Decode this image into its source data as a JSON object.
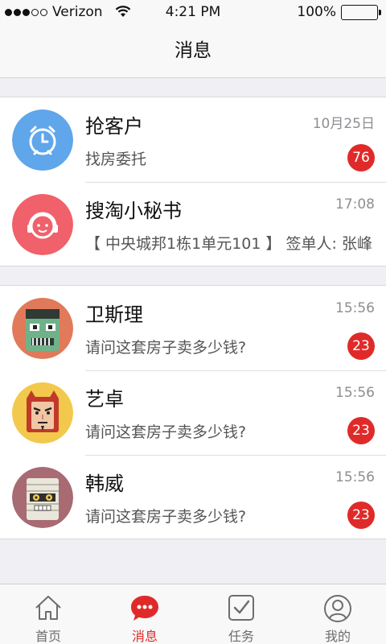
{
  "status_bar": {
    "carrier": "Verizon",
    "time": "4:21 PM",
    "battery": "100%"
  },
  "nav": {
    "title": "消息"
  },
  "group1": [
    {
      "title": "抢客户",
      "time": "10月25日",
      "subtitle": "找房委托",
      "badge": "76",
      "avatar_icon": "alarm-clock-icon",
      "avatar_color": "#5fa6ea"
    },
    {
      "title": "搜淘小秘书",
      "time": "17:08",
      "subtitle": "【 中央城邦1栋1单元101 】 签单人: 张峰",
      "avatar_icon": "headset-icon",
      "avatar_color": "#f0616b"
    }
  ],
  "group2": [
    {
      "title": "卫斯理",
      "time": "15:56",
      "subtitle": "请问这套房子卖多少钱?",
      "badge": "23",
      "avatar_icon": "zombie-avatar-icon",
      "avatar_color": "#e07a5a"
    },
    {
      "title": "艺卓",
      "time": "15:56",
      "subtitle": "请问这套房子卖多少钱?",
      "badge": "23",
      "avatar_icon": "devil-avatar-icon",
      "avatar_color": "#f2c94c"
    },
    {
      "title": "韩威",
      "time": "15:56",
      "subtitle": "请问这套房子卖多少钱?",
      "badge": "23",
      "avatar_icon": "mummy-avatar-icon",
      "avatar_color": "#a86a73"
    }
  ],
  "tabs": [
    {
      "label": "首页",
      "icon": "home-icon",
      "active": false
    },
    {
      "label": "消息",
      "icon": "chat-bubble-icon",
      "active": true
    },
    {
      "label": "任务",
      "icon": "task-check-icon",
      "active": false
    },
    {
      "label": "我的",
      "icon": "profile-icon",
      "active": false
    }
  ],
  "colors": {
    "accent": "#e02a2a",
    "badge": "#e02a2a"
  }
}
